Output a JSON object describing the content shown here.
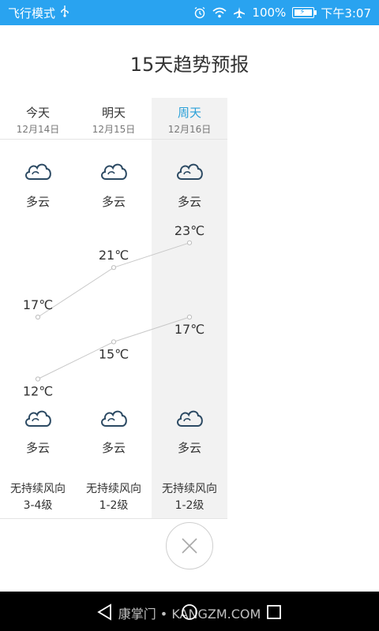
{
  "status_bar": {
    "mode_text": "飞行模式",
    "battery_text": "100%",
    "time_text": "下午3:07",
    "icons": [
      "usb-icon",
      "alarm-icon",
      "wifi-icon",
      "airplane-icon",
      "battery-charging-icon"
    ]
  },
  "page": {
    "title": "15天趋势预报"
  },
  "forecast": {
    "selected_index": 2,
    "days": [
      {
        "name": "今天",
        "date": "12月14日",
        "day_weather": "多云",
        "night_weather": "多云",
        "high": 17,
        "high_label": "17℃",
        "low": 12,
        "low_label": "12℃",
        "wind_dir": "无持续风向",
        "wind_level": "3-4级"
      },
      {
        "name": "明天",
        "date": "12月15日",
        "day_weather": "多云",
        "night_weather": "多云",
        "high": 21,
        "high_label": "21℃",
        "low": 15,
        "low_label": "15℃",
        "wind_dir": "无持续风向",
        "wind_level": "1-2级"
      },
      {
        "name": "周天",
        "date": "12月16日",
        "day_weather": "多云",
        "night_weather": "多云",
        "high": 23,
        "high_label": "23℃",
        "low": 17,
        "low_label": "17℃",
        "wind_dir": "无持续风向",
        "wind_level": "1-2级"
      }
    ]
  },
  "close_icon": "close-icon",
  "nav": {
    "icons": [
      "back-icon",
      "home-icon",
      "recents-icon"
    ]
  },
  "watermark": "康掌门 • KANGZM.COM",
  "colors": {
    "status_bar": "#29a3f0",
    "selected_day": "#2aa0d8",
    "selected_column_bg": "#f2f2f2"
  }
}
